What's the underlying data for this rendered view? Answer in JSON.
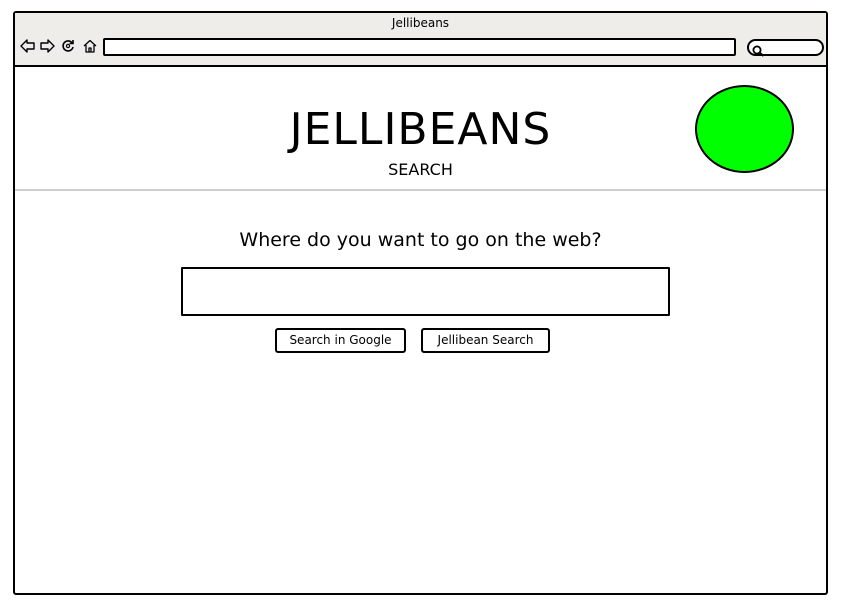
{
  "window": {
    "title": "Jellibeans"
  },
  "toolbar": {
    "icons": [
      "back-arrow-icon",
      "forward-arrow-icon",
      "reload-icon",
      "home-icon",
      "search-icon"
    ],
    "address_value": ""
  },
  "header": {
    "brand": "JELLIBEANS",
    "subtitle": "SEARCH",
    "circle_color": "#00ff00"
  },
  "main": {
    "question": "Where do you want to go on the web?",
    "search_value": "",
    "buttons": {
      "google": "Search in Google",
      "jellibean": "Jellibean Search"
    }
  }
}
